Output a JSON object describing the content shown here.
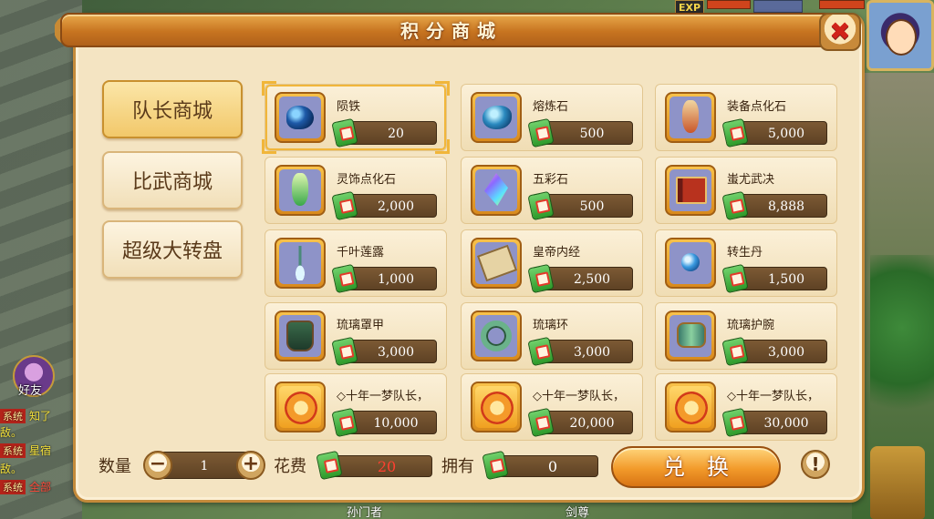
{
  "hud": {
    "exp_label": "EXP"
  },
  "chat": {
    "friend_label": "好友",
    "lines": [
      {
        "tag": "系统",
        "text": "知了"
      },
      {
        "tag": "",
        "text": "敌。"
      },
      {
        "tag": "系统",
        "text": "星宿"
      },
      {
        "tag": "",
        "text": "敌。"
      },
      {
        "tag": "系统",
        "text": "全部"
      }
    ]
  },
  "bottom_names": [
    "孙门者",
    "剑尊"
  ],
  "shop": {
    "title": "积分商城",
    "close_symbol": "✖",
    "tabs": [
      {
        "label": "队长商城",
        "active": true
      },
      {
        "label": "比武商城",
        "active": false
      },
      {
        "label": "超级大转盘",
        "active": false
      }
    ],
    "items": [
      {
        "name": "陨铁",
        "price": "20",
        "icon": "meteor-iron-icon",
        "selected": true
      },
      {
        "name": "熔炼石",
        "price": "500",
        "icon": "smelting-stone-icon"
      },
      {
        "name": "装备点化石",
        "price": "5,000",
        "icon": "equipment-vase-icon"
      },
      {
        "name": "灵饰点化石",
        "price": "2,000",
        "icon": "accessory-vase-icon"
      },
      {
        "name": "五彩石",
        "price": "500",
        "icon": "five-color-crystal-icon"
      },
      {
        "name": "蚩尤武决",
        "price": "8,888",
        "icon": "martial-book-icon"
      },
      {
        "name": "千叶莲露",
        "price": "1,000",
        "icon": "lotus-dew-icon"
      },
      {
        "name": "皇帝内经",
        "price": "2,500",
        "icon": "scripture-scroll-icon"
      },
      {
        "name": "转生丹",
        "price": "1,500",
        "icon": "rebirth-pill-icon"
      },
      {
        "name": "琉璃罩甲",
        "price": "3,000",
        "icon": "glass-armor-icon"
      },
      {
        "name": "琉璃环",
        "price": "3,000",
        "icon": "glass-ring-icon"
      },
      {
        "name": "琉璃护腕",
        "price": "3,000",
        "icon": "glass-bracer-icon"
      },
      {
        "name": "◇十年一梦队长，",
        "price": "10,000",
        "icon": "captain-ticket-icon"
      },
      {
        "name": "◇十年一梦队长，",
        "price": "20,000",
        "icon": "captain-ticket-icon"
      },
      {
        "name": "◇十年一梦队长，",
        "price": "30,000",
        "icon": "captain-ticket-icon"
      }
    ],
    "footer": {
      "quantity_label": "数量",
      "quantity_value": "1",
      "minus": "−",
      "plus": "+",
      "cost_label": "花费",
      "cost_value": "20",
      "owned_label": "拥有",
      "owned_value": "0",
      "exchange_label": "兑换",
      "info_symbol": "!"
    }
  }
}
